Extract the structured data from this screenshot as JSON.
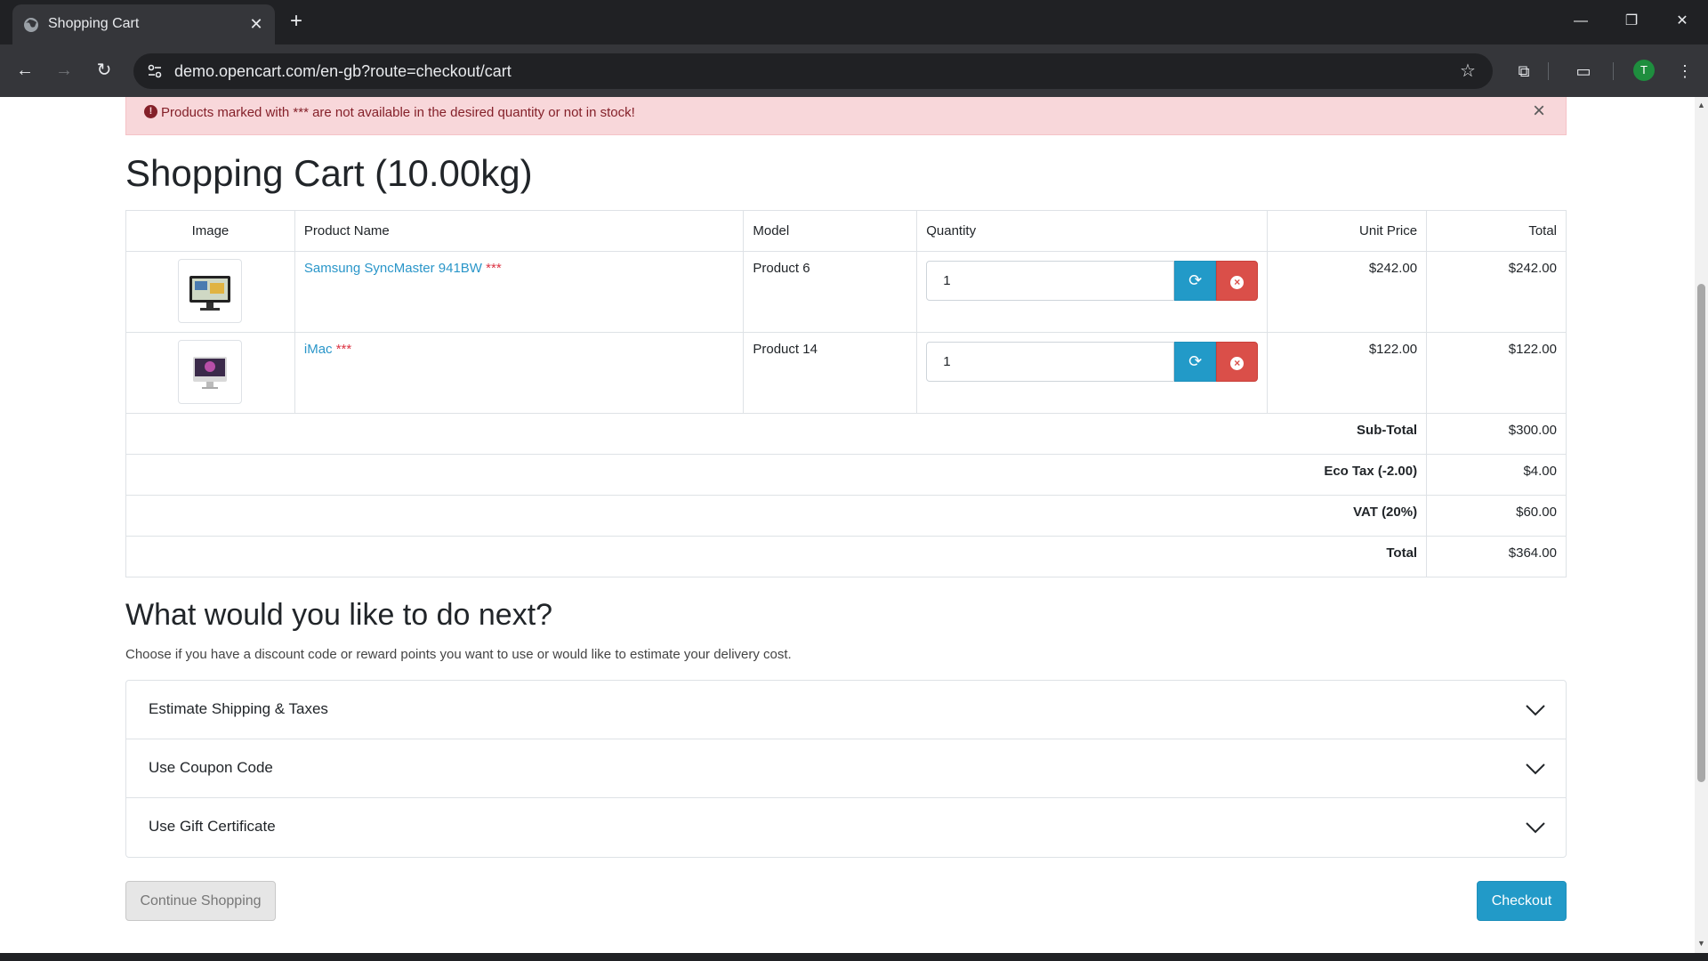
{
  "browser": {
    "tab_title": "Shopping Cart",
    "url": "demo.opencart.com/en-gb?route=checkout/cart",
    "profile_initial": "T"
  },
  "alert": {
    "message": "Products marked with *** are not available in the desired quantity or not in stock!"
  },
  "page": {
    "title": "Shopping Cart (10.00kg)"
  },
  "cart": {
    "headers": {
      "image": "Image",
      "product_name": "Product Name",
      "model": "Model",
      "quantity": "Quantity",
      "unit_price": "Unit Price",
      "total": "Total"
    },
    "items": [
      {
        "name": "Samsung SyncMaster 941BW",
        "stock_marker": "***",
        "model": "Product 6",
        "quantity": "1",
        "unit_price": "$242.00",
        "total": "$242.00"
      },
      {
        "name": "iMac",
        "stock_marker": "***",
        "model": "Product 14",
        "quantity": "1",
        "unit_price": "$122.00",
        "total": "$122.00"
      }
    ],
    "totals": [
      {
        "label": "Sub-Total",
        "value": "$300.00"
      },
      {
        "label": "Eco Tax (-2.00)",
        "value": "$4.00"
      },
      {
        "label": "VAT (20%)",
        "value": "$60.00"
      },
      {
        "label": "Total",
        "value": "$364.00"
      }
    ]
  },
  "next": {
    "heading": "What would you like to do next?",
    "description": "Choose if you have a discount code or reward points you want to use or would like to estimate your delivery cost.",
    "sections": [
      {
        "label": "Estimate Shipping & Taxes"
      },
      {
        "label": "Use Coupon Code"
      },
      {
        "label": "Use Gift Certificate"
      }
    ]
  },
  "actions": {
    "continue_label": "Continue Shopping",
    "checkout_label": "Checkout"
  },
  "colors": {
    "accent": "#229ac8",
    "danger": "#da4f49",
    "alert_bg": "#f8d7da",
    "link": "#2a96c9"
  },
  "icons": {
    "refresh": "refresh-icon",
    "remove": "remove-icon",
    "chevron": "chevron-down-icon",
    "alert": "exclamation-circle-icon"
  }
}
